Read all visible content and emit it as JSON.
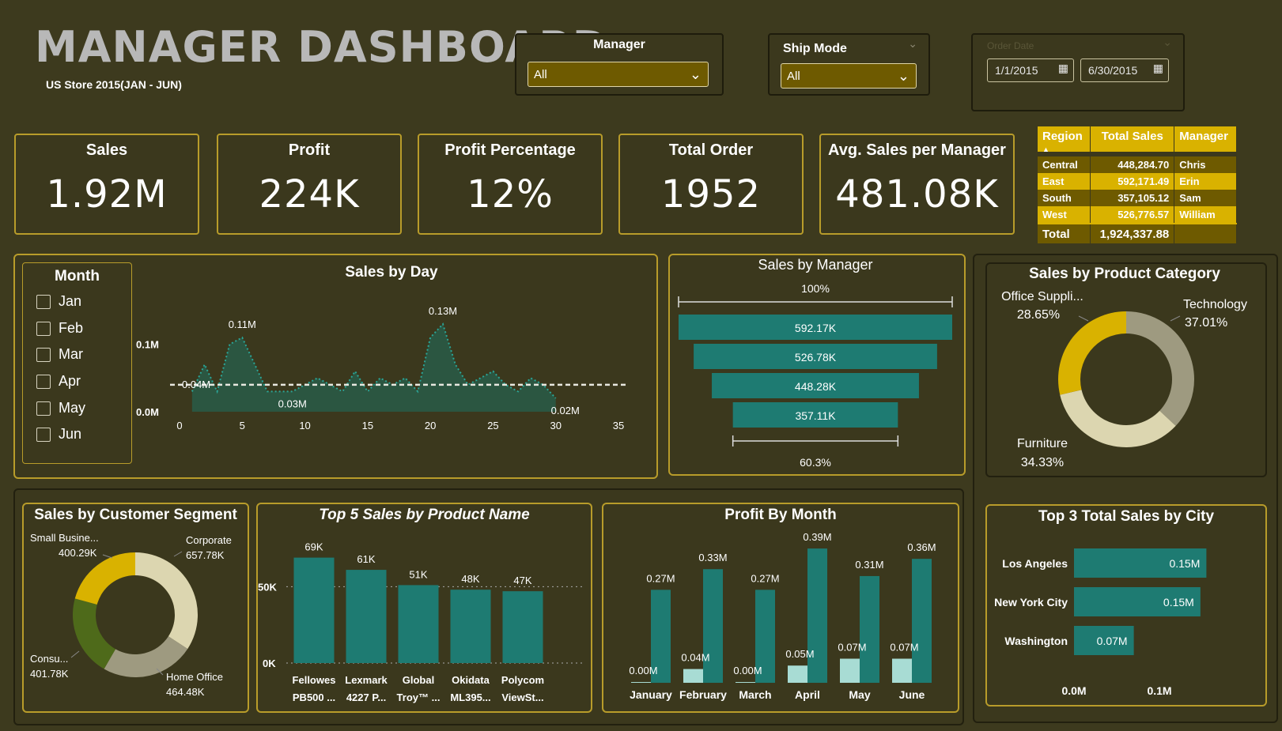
{
  "header": {
    "title": "MANAGER DASHBOARD",
    "subtitle": "US Store 2015(JAN - JUN)"
  },
  "filters": {
    "manager": {
      "label": "Manager",
      "value": "All"
    },
    "ship_mode": {
      "label": "Ship Mode",
      "value": "All"
    },
    "order_date": {
      "label": "Order Date",
      "start": "1/1/2015",
      "end": "6/30/2015"
    }
  },
  "kpis": [
    {
      "label": "Sales",
      "value": "1.92M"
    },
    {
      "label": "Profit",
      "value": "224K"
    },
    {
      "label": "Profit Percentage",
      "value": "12%"
    },
    {
      "label": "Total Order",
      "value": "1952"
    },
    {
      "label": "Avg. Sales per Manager",
      "value": "481.08K"
    }
  ],
  "region_table": {
    "columns": [
      "Region",
      "Total Sales",
      "Manager"
    ],
    "rows": [
      [
        "Central",
        "448,284.70",
        "Chris"
      ],
      [
        "East",
        "592,171.49",
        "Erin"
      ],
      [
        "South",
        "357,105.12",
        "Sam"
      ],
      [
        "West",
        "526,776.57",
        "William"
      ]
    ],
    "total": [
      "Total",
      "1,924,337.88",
      ""
    ]
  },
  "month_slicer": {
    "title": "Month",
    "items": [
      "Jan",
      "Feb",
      "Mar",
      "Apr",
      "May",
      "Jun"
    ]
  },
  "colors": {
    "teal": "#1e7b72",
    "light_teal": "#a8dcd4",
    "gold": "#d9b200",
    "khaki": "#9e9a80",
    "cream": "#dcd6b0",
    "olive": "#4e6a1a",
    "bg": "#3d3a1e"
  },
  "chart_data": [
    {
      "type": "area",
      "title": "Sales by Day",
      "x": [
        1,
        2,
        3,
        4,
        5,
        6,
        7,
        8,
        9,
        10,
        11,
        12,
        13,
        14,
        15,
        16,
        17,
        18,
        19,
        20,
        21,
        22,
        23,
        24,
        25,
        26,
        27,
        28,
        29,
        30
      ],
      "values": [
        0.03,
        0.07,
        0.03,
        0.1,
        0.11,
        0.07,
        0.03,
        0.03,
        0.03,
        0.04,
        0.05,
        0.04,
        0.03,
        0.06,
        0.03,
        0.05,
        0.04,
        0.05,
        0.03,
        0.11,
        0.13,
        0.07,
        0.04,
        0.05,
        0.06,
        0.04,
        0.03,
        0.05,
        0.04,
        0.02
      ],
      "reference_line": 0.04,
      "reference_label": "0.04M",
      "annotations": [
        {
          "x": 5,
          "label": "0.11M"
        },
        {
          "x": 9,
          "label": "0.03M"
        },
        {
          "x": 21,
          "label": "0.13M"
        },
        {
          "x": 30,
          "label": "0.02M"
        }
      ],
      "y_ticks": [
        "0.0M",
        "0.1M"
      ],
      "x_ticks": [
        "0",
        "5",
        "10",
        "15",
        "20",
        "25",
        "30",
        "35"
      ],
      "xlim": [
        0,
        35
      ],
      "ylim": [
        0,
        0.15
      ]
    },
    {
      "type": "bar",
      "title": "Sales by Manager",
      "orientation": "funnel",
      "values": [
        592.17,
        526.78,
        448.28,
        357.11
      ],
      "labels": [
        "592.17K",
        "526.78K",
        "448.28K",
        "357.11K"
      ],
      "top_label": "100%",
      "bottom_label": "60.3%"
    },
    {
      "type": "pie",
      "title": "Sales by Product Category",
      "donut": true,
      "categories": [
        "Technology",
        "Furniture",
        "Office Suppli..."
      ],
      "values": [
        37.01,
        34.33,
        28.65
      ],
      "labels": [
        "37.01%",
        "34.33%",
        "28.65%"
      ]
    },
    {
      "type": "pie",
      "title": "Sales by Customer Segment",
      "donut": true,
      "categories": [
        "Corporate",
        "Home Office",
        "Consu...",
        "Small Busine..."
      ],
      "values": [
        657.78,
        464.48,
        401.78,
        400.29
      ],
      "labels": [
        "657.78K",
        "464.48K",
        "401.78K",
        "400.29K"
      ]
    },
    {
      "type": "bar",
      "title": "Top 5 Sales by Product Name",
      "categories": [
        "Fellowes PB500 ...",
        "Lexmark 4227 P...",
        "Global Troy™ ...",
        "Okidata ML395...",
        "Polycom ViewSt..."
      ],
      "category_lines": [
        [
          "Fellowes",
          "PB500 ..."
        ],
        [
          "Lexmark",
          "4227 P..."
        ],
        [
          "Global",
          "Troy™ ..."
        ],
        [
          "Okidata",
          "ML395..."
        ],
        [
          "Polycom",
          "ViewSt..."
        ]
      ],
      "values": [
        69,
        61,
        51,
        48,
        47
      ],
      "labels": [
        "69K",
        "61K",
        "51K",
        "48K",
        "47K"
      ],
      "y_ticks": [
        "0K",
        "50K"
      ],
      "ylim": [
        0,
        75
      ]
    },
    {
      "type": "bar",
      "title": "Profit By Month",
      "categories": [
        "January",
        "February",
        "March",
        "April",
        "May",
        "June"
      ],
      "series": [
        {
          "values": [
            0.0,
            0.04,
            0.0,
            0.05,
            0.07,
            0.07
          ],
          "labels": [
            "0.00M",
            "0.04M",
            "0.00M",
            "0.05M",
            "0.07M",
            "0.07M"
          ]
        },
        {
          "values": [
            0.27,
            0.33,
            0.27,
            0.39,
            0.31,
            0.36
          ],
          "labels": [
            "0.27M",
            "0.33M",
            "0.27M",
            "0.39M",
            "0.31M",
            "0.36M"
          ]
        }
      ],
      "ylim": [
        0,
        0.42
      ]
    },
    {
      "type": "bar",
      "title": "Top 3 Total Sales by City",
      "orientation": "horizontal",
      "categories": [
        "Los Angeles",
        "New York City",
        "Washington"
      ],
      "values": [
        0.155,
        0.148,
        0.07
      ],
      "labels": [
        "0.15M",
        "0.15M",
        "0.07M"
      ],
      "x_ticks": [
        "0.0M",
        "0.1M"
      ],
      "xlim": [
        0,
        0.2
      ]
    }
  ]
}
